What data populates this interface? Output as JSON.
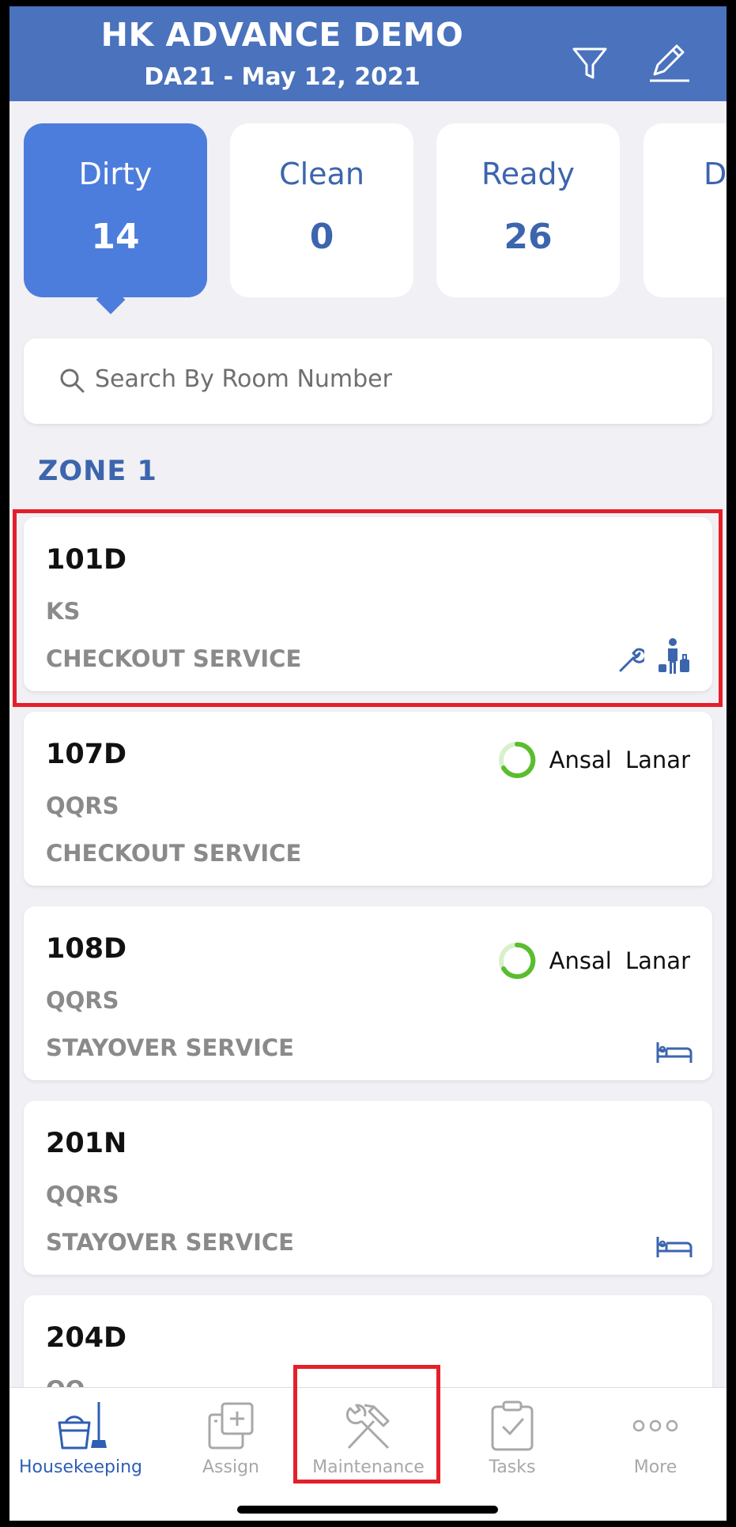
{
  "header": {
    "title": "HK ADVANCE DEMO",
    "subtitle": "DA21 - May 12, 2021",
    "filter_icon": "filter-icon",
    "edit_icon": "edit-icon"
  },
  "status_tabs": [
    {
      "label": "Dirty",
      "count": "14",
      "active": true
    },
    {
      "label": "Clean",
      "count": "0",
      "active": false
    },
    {
      "label": "Ready",
      "count": "26",
      "active": false
    },
    {
      "label": "Di",
      "count": "",
      "active": false
    }
  ],
  "search": {
    "placeholder": "Search By Room Number",
    "icon": "search-icon"
  },
  "zone": {
    "title": "ZONE 1",
    "rooms": [
      {
        "number": "101D",
        "type": "KS",
        "service": "CHECKOUT SERVICE",
        "assignee": "",
        "icons": [
          "wrench-icon",
          "guest-luggage-icon"
        ]
      },
      {
        "number": "107D",
        "type": "QQRS",
        "service": "CHECKOUT SERVICE",
        "assignee": "Ansal Lanar",
        "icons": []
      },
      {
        "number": "108D",
        "type": "QQRS",
        "service": "STAYOVER SERVICE",
        "assignee": "Ansal Lanar",
        "icons": [
          "bed-icon"
        ]
      },
      {
        "number": "201N",
        "type": "QQRS",
        "service": "STAYOVER SERVICE",
        "assignee": "",
        "icons": [
          "bed-icon"
        ]
      },
      {
        "number": "204D",
        "type": "QQ",
        "service": "",
        "assignee": "",
        "icons": []
      }
    ]
  },
  "bottom_nav": [
    {
      "label": "Housekeeping",
      "icon": "housekeeping-bucket-icon",
      "active": true
    },
    {
      "label": "Assign",
      "icon": "assign-icon",
      "active": false
    },
    {
      "label": "Maintenance",
      "icon": "tools-icon",
      "active": false
    },
    {
      "label": "Tasks",
      "icon": "clipboard-check-icon",
      "active": false
    },
    {
      "label": "More",
      "icon": "more-dots-icon",
      "active": false
    }
  ],
  "colors": {
    "header_bg": "#4a72bd",
    "active_tab": "#4d7ddc",
    "accent_text": "#3c65ad",
    "highlight": "#e3202a",
    "progress_green": "#5bbd2e"
  }
}
